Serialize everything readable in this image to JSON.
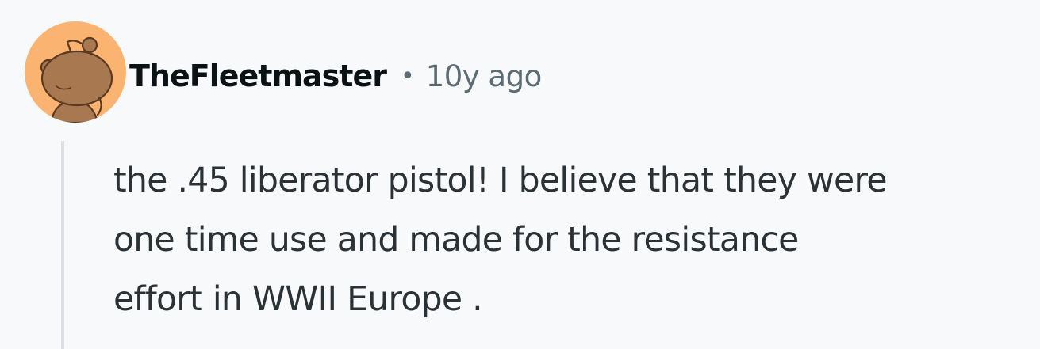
{
  "comment": {
    "author": "TheFleetmaster",
    "separator": "•",
    "timestamp": "10y ago",
    "body": "the .45 liberator pistol! I believe that they were\none time use and made for the resistance\neffort in WWII Europe .",
    "avatar_icon": "snoo-avatar-icon"
  },
  "colors": {
    "background": "#f8f9fb",
    "avatar_bg": "#fbb372",
    "snoo_body": "#a87850",
    "author_text": "#0b1216",
    "meta_text": "#5c6c74",
    "body_text": "#2a3236",
    "thread_line": "#dbe0e6"
  }
}
